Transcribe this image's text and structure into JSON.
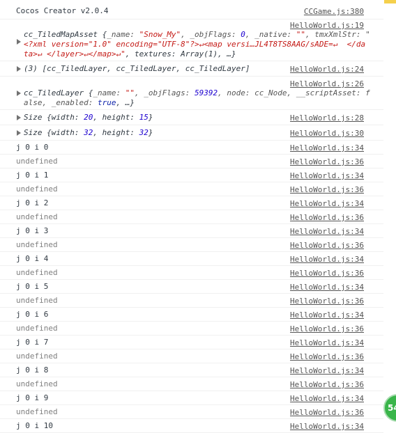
{
  "header": {
    "message": "Cocos Creator v2.0.4",
    "source": "CCGame.js:380"
  },
  "tiled_map_asset": {
    "source": "HelloWorld.js:19",
    "line1_label": "cc_TiledMapAsset {",
    "line1_name_key": "_name: ",
    "line1_name_val": "\"Snow_My\"",
    "line1_flags_key": ", _objFlags: ",
    "line1_flags_val": "0",
    "line1_native_key": ", _native: ",
    "line1_native_val": "\"\"",
    "line1_tmx_key": ", tmxXmlStr: \"",
    "line2": "<?xml version=\"1.0\" encoding=\"UTF-8\"?>↵<map versi…JL4T8TS8AAG/sADE=↵  </da",
    "line3_red": "ta>↵ </layer>↵</map>↵\"",
    "line3_tail": ", textures: Array(1), …}"
  },
  "layers_array": {
    "text": "(3) [cc_TiledLayer, cc_TiledLayer, cc_TiledLayer]",
    "source": "HelloWorld.js:24"
  },
  "tiled_layer": {
    "source": "HelloWorld.js:26",
    "line1_label": "cc_TiledLayer {",
    "line1_name_key": "_name: ",
    "line1_name_val": "\"\"",
    "line1_flags_key": ", _objFlags: ",
    "line1_flags_val": "59392",
    "line1_rest": ", node: cc_Node, __scriptAsset: f",
    "line2_a": "alse, _enabled: ",
    "line2_kw": "true",
    "line2_b": ", …}"
  },
  "size_rows": [
    {
      "prefix": "Size {width: ",
      "w": "20",
      "mid": ", height: ",
      "h": "15",
      "suffix": "}",
      "source": "HelloWorld.js:28"
    },
    {
      "prefix": "Size {width: ",
      "w": "32",
      "mid": ", height: ",
      "h": "32",
      "suffix": "}",
      "source": "HelloWorld.js:30"
    }
  ],
  "log_rows": [
    {
      "text": "j 0 i 0",
      "source": "HelloWorld.js:34"
    },
    {
      "text": "undefined",
      "source": "HelloWorld.js:36"
    },
    {
      "text": "j 0 i 1",
      "source": "HelloWorld.js:34"
    },
    {
      "text": "undefined",
      "source": "HelloWorld.js:36"
    },
    {
      "text": "j 0 i 2",
      "source": "HelloWorld.js:34"
    },
    {
      "text": "undefined",
      "source": "HelloWorld.js:36"
    },
    {
      "text": "j 0 i 3",
      "source": "HelloWorld.js:34"
    },
    {
      "text": "undefined",
      "source": "HelloWorld.js:36"
    },
    {
      "text": "j 0 i 4",
      "source": "HelloWorld.js:34"
    },
    {
      "text": "undefined",
      "source": "HelloWorld.js:36"
    },
    {
      "text": "j 0 i 5",
      "source": "HelloWorld.js:34"
    },
    {
      "text": "undefined",
      "source": "HelloWorld.js:36"
    },
    {
      "text": "j 0 i 6",
      "source": "HelloWorld.js:34"
    },
    {
      "text": "undefined",
      "source": "HelloWorld.js:36"
    },
    {
      "text": "j 0 i 7",
      "source": "HelloWorld.js:34"
    },
    {
      "text": "undefined",
      "source": "HelloWorld.js:36"
    },
    {
      "text": "j 0 i 8",
      "source": "HelloWorld.js:34"
    },
    {
      "text": "undefined",
      "source": "HelloWorld.js:36"
    },
    {
      "text": "j 0 i 9",
      "source": "HelloWorld.js:34"
    },
    {
      "text": "undefined",
      "source": "HelloWorld.js:36"
    },
    {
      "text": "j 0 i 10",
      "source": "HelloWorld.js:34"
    }
  ],
  "floating_badge": {
    "label": "54"
  }
}
